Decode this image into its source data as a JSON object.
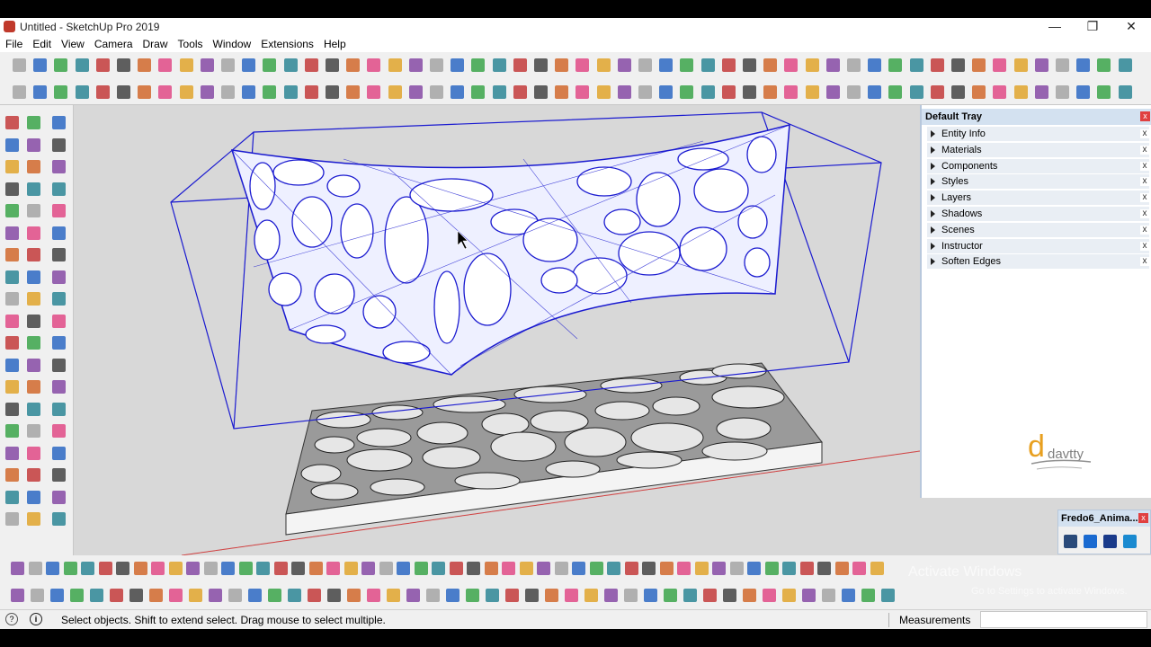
{
  "window": {
    "title": "Untitled - SketchUp Pro 2019",
    "minimize": "—",
    "maximize": "❐",
    "close": "✕"
  },
  "menu": [
    "File",
    "Edit",
    "View",
    "Camera",
    "Draw",
    "Tools",
    "Window",
    "Extensions",
    "Help"
  ],
  "tray": {
    "title": "Default Tray",
    "close": "x",
    "panels": [
      {
        "label": "Entity Info"
      },
      {
        "label": "Materials"
      },
      {
        "label": "Components"
      },
      {
        "label": "Styles"
      },
      {
        "label": "Layers"
      },
      {
        "label": "Shadows"
      },
      {
        "label": "Scenes"
      },
      {
        "label": "Instructor"
      },
      {
        "label": "Soften Edges"
      }
    ],
    "panel_close": "x"
  },
  "fredo_toolbar": {
    "title": "Fredo6_Anima...",
    "close": "x"
  },
  "logo_text": {
    "brand": "davtty"
  },
  "watermark": {
    "line1": "Activate Windows",
    "line2": "Go to Settings to activate Windows."
  },
  "status": {
    "help_icon": "?",
    "info_icon": "i",
    "text": "Select objects. Shift to extend select. Drag mouse to select multiple.",
    "measurements_label": "Measurements",
    "measurements_value": ""
  },
  "colors": {
    "selection_blue": "#1a1ad0",
    "axis_red": "#d04040",
    "tray_header": "#d3e1f0",
    "viewport_bg": "#d8d8d8"
  },
  "icons": {
    "top_row1": [
      "select-icon",
      "eraser-icon",
      "line-icon",
      "arc-icon",
      "shape-icon",
      "push-pull-icon",
      "follow-me-icon",
      "move-icon",
      "rotate-icon",
      "offset-icon",
      "tape-icon",
      "dimension-icon",
      "paint-icon",
      "orbit-icon",
      "pan-icon",
      "zoom-icon",
      "zoom-extents-icon",
      "warehouse-icon",
      "extension-warehouse-icon",
      "layout-icon",
      "ruby-icon",
      "user-icon",
      "section-icon",
      "view-iso-icon",
      "view-top-icon",
      "view-front-icon",
      "view-right-icon",
      "view-back-icon",
      "view-left-icon"
    ],
    "top_row2": [
      "axes-icon",
      "paint-bucket-icon",
      "polygon-icon",
      "circle-icon",
      "ellipse-icon",
      "rectangle-icon",
      "spline-icon",
      "arc3-icon",
      "bezier-icon",
      "curve-icon",
      "solid-tools-icon",
      "union-icon",
      "house-icon",
      "roof-icon",
      "wall-icon",
      "door-icon",
      "window-icon",
      "stair-icon",
      "sandbox-icon",
      "shadow-icon",
      "fog-icon",
      "match-photo-icon",
      "texture-icon",
      "cube-icon",
      "layer-icon"
    ]
  }
}
